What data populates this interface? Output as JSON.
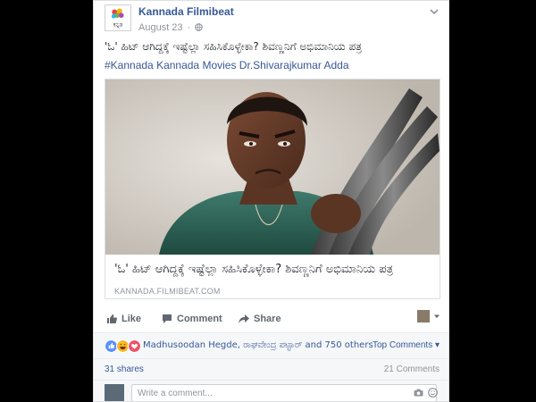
{
  "post": {
    "page_name": "Kannada Filmibeat",
    "logo_text": "ಕನ್ನಡ",
    "date": "August 23",
    "dot": "·",
    "text": "'ಓ' ಹಿಟ್ ಆಗಿದ್ದಕ್ಕೆ ಇಷ್ಟೆಲ್ಲಾ ಸಹಿಸಿಕೊಳ್ಳೇಕಾ? ಶಿವಣ್ಣನಿಗೆ ಅಭಿಮಾನಿಯ ಪತ್ರ",
    "hashtags": [
      "#Kannada",
      "Kannada Movies",
      "Dr.Shivarajkumar",
      "Adda"
    ]
  },
  "link": {
    "title": "'ಓ' ಹಿಟ್ ಆಗಿದ್ದಕ್ಕೆ ಇಷ್ಟೆಲ್ಲಾ ಸಹಿಸಿಕೊಳ್ಳೇಕಾ? ಶಿವಣ್ಣನಿಗೆ ಅಭಿಮಾನಿಯ ಪತ್ರ",
    "domain": "KANNADA.FILMIBEAT.COM"
  },
  "actions": {
    "like": "Like",
    "comment": "Comment",
    "share": "Share"
  },
  "reactions": {
    "names": "Madhusoodan Hegde, ರಾಘವೇಂದ್ರ ಪಟ್ಟಾರ್ and 750 others",
    "top_comments": "Top Comments ▾",
    "colors": {
      "like": "#5890ff",
      "haha": "#f7b928",
      "love": "#f25268"
    }
  },
  "stats": {
    "shares": "31 shares",
    "comments": "21 Comments"
  },
  "comment_box": {
    "placeholder": "Write a comment..."
  },
  "colors": {
    "link": "#365899",
    "muted": "#90949c",
    "border": "#dddfe2"
  }
}
